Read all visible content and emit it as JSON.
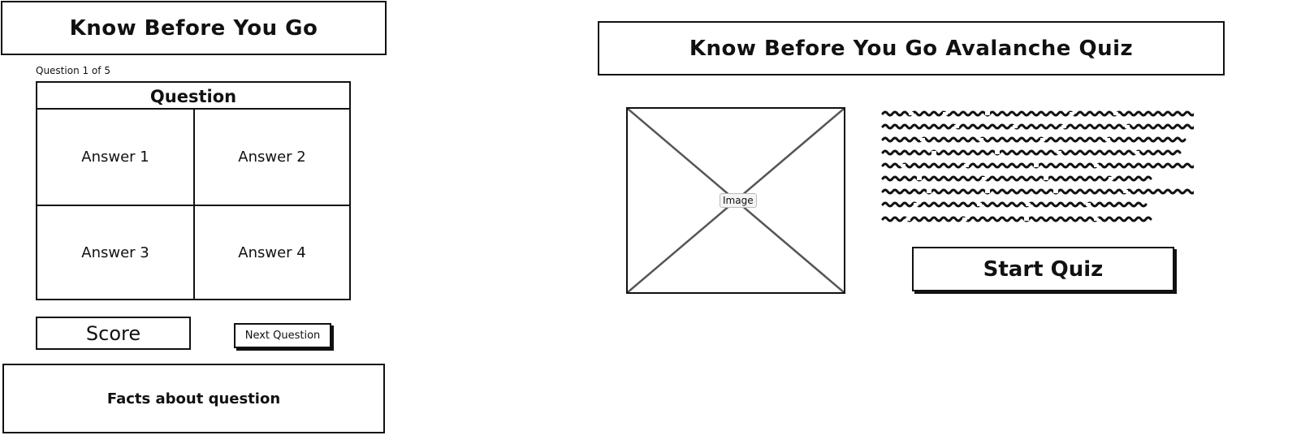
{
  "left": {
    "header_title": "Know Before You Go",
    "question_counter": "Question 1 of 5",
    "question_label": "Question",
    "answers": [
      "Answer 1",
      "Answer 2",
      "Answer 3",
      "Answer 4"
    ],
    "score_label": "Score",
    "next_button_label": "Next Question",
    "facts_label": "Facts about question"
  },
  "right": {
    "header_title": "Know Before You Go Avalanche Quiz",
    "image_placeholder_label": "Image",
    "start_button_label": "Start Quiz"
  }
}
